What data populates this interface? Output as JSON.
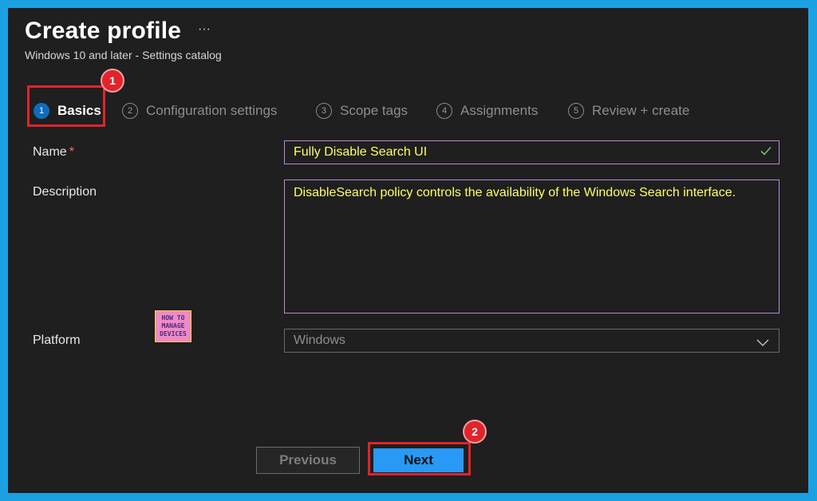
{
  "header": {
    "title": "Create profile",
    "more_label": "···",
    "subtitle": "Windows 10 and later - Settings catalog"
  },
  "steps": [
    {
      "num": "1",
      "label": "Basics",
      "active": true
    },
    {
      "num": "2",
      "label": "Configuration settings",
      "active": false
    },
    {
      "num": "3",
      "label": "Scope tags",
      "active": false
    },
    {
      "num": "4",
      "label": "Assignments",
      "active": false
    },
    {
      "num": "5",
      "label": "Review + create",
      "active": false
    }
  ],
  "form": {
    "name_label": "Name",
    "required_marker": "*",
    "name_value": "Fully Disable Search UI",
    "description_label": "Description",
    "description_value": "DisableSearch policy controls the availability of the Windows Search interface.",
    "platform_label": "Platform",
    "platform_value": "Windows"
  },
  "annotations": {
    "badge_1": "1",
    "badge_2": "2",
    "annotation_color": "#e0242b"
  },
  "logo": {
    "line1": "HOW TO",
    "line2": "MANAGE",
    "line3": "DEVICES"
  },
  "footer": {
    "previous_label": "Previous",
    "next_label": "Next"
  },
  "colors": {
    "accent": "#2899f5",
    "highlight_text": "#ffff66",
    "background": "#1f1f1f",
    "outer_border": "#1ba1e2"
  }
}
